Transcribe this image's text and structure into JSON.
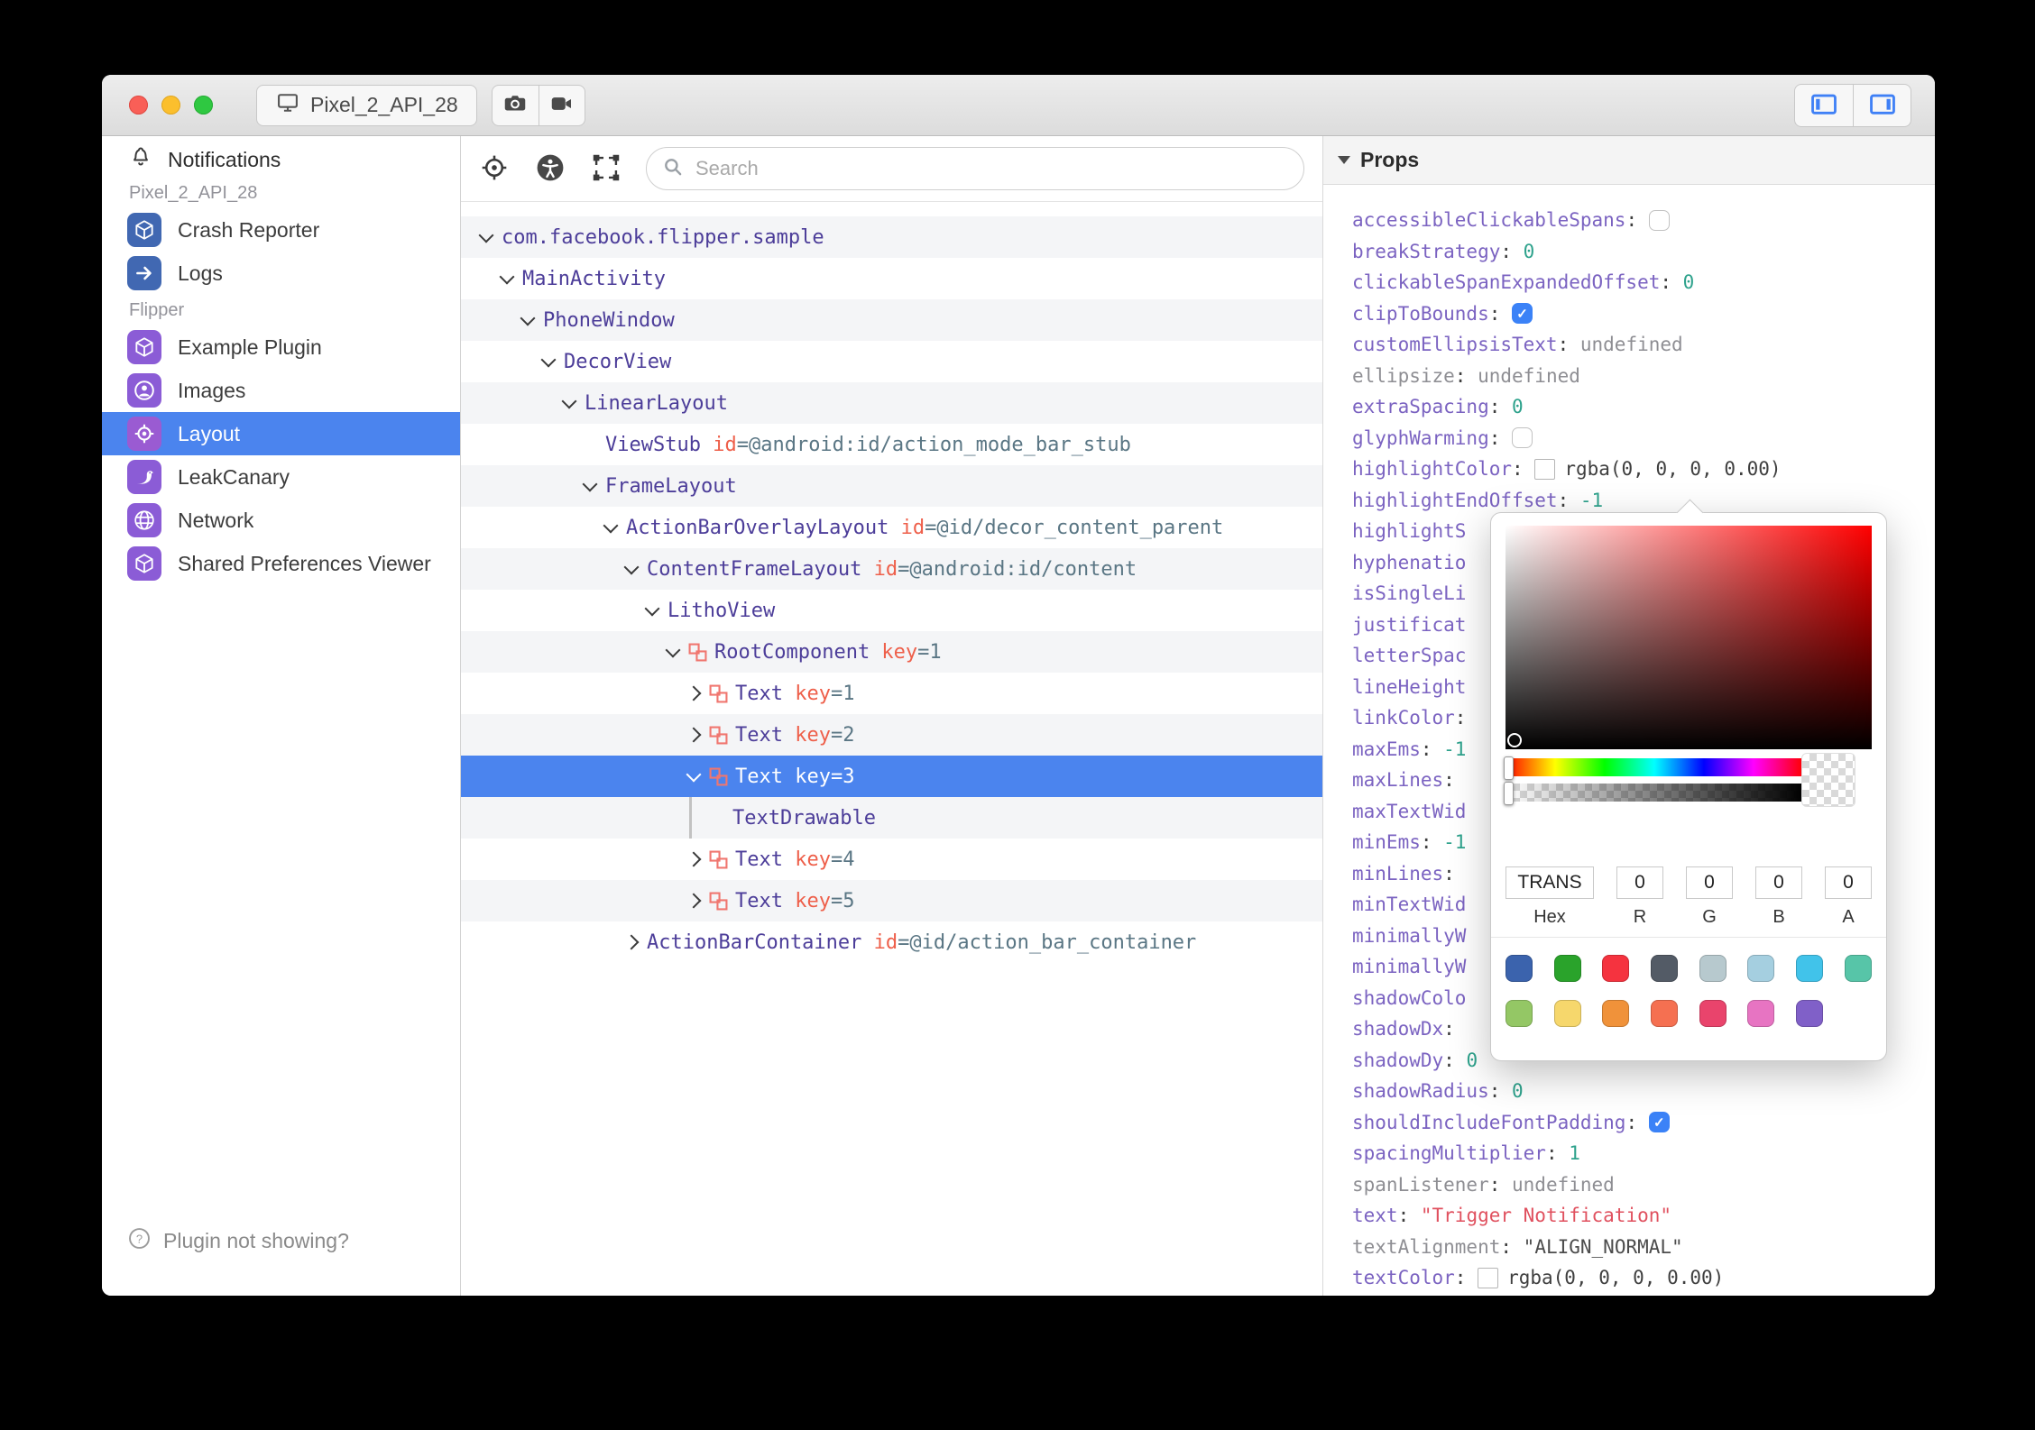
{
  "titlebar": {
    "device_label": "Pixel_2_API_28"
  },
  "sidebar": {
    "notifications": {
      "label": "Notifications",
      "icon": "bell-icon"
    },
    "sections": [
      {
        "label": "Pixel_2_API_28",
        "items": [
          {
            "label": "Crash Reporter",
            "icon": "cube-icon",
            "color": "#4168b2",
            "selected": false
          },
          {
            "label": "Logs",
            "icon": "arrow-right-icon",
            "color": "#4168b2",
            "selected": false
          }
        ]
      },
      {
        "label": "Flipper",
        "items": [
          {
            "label": "Example Plugin",
            "icon": "cube-icon",
            "color": "#8b5cd6",
            "selected": false
          },
          {
            "label": "Images",
            "icon": "person-circle-icon",
            "color": "#8b5cd6",
            "selected": false
          },
          {
            "label": "Layout",
            "icon": "target-icon",
            "color": "#9a5bd2",
            "selected": true
          },
          {
            "label": "LeakCanary",
            "icon": "bird-icon",
            "color": "#8b5cd6",
            "selected": false
          },
          {
            "label": "Network",
            "icon": "globe-icon",
            "color": "#8b5cd6",
            "selected": false
          },
          {
            "label": "Shared Preferences Viewer",
            "icon": "cube-icon",
            "color": "#8b5cd6",
            "selected": false
          }
        ]
      }
    ],
    "footer": {
      "label": "Plugin not showing?",
      "icon": "help-circle-icon"
    }
  },
  "toolbar": {
    "search_placeholder": "Search"
  },
  "tree": {
    "rows": [
      {
        "name": "com.facebook.flipper.sample",
        "level": 0,
        "exp": "open"
      },
      {
        "name": "MainActivity",
        "level": 1,
        "exp": "open"
      },
      {
        "name": "PhoneWindow",
        "level": 2,
        "exp": "open"
      },
      {
        "name": "DecorView",
        "level": 3,
        "exp": "open"
      },
      {
        "name": "LinearLayout",
        "level": 4,
        "exp": "open"
      },
      {
        "name": "ViewStub",
        "level": 5,
        "exp": "none",
        "attr": {
          "k": "id",
          "v": "=@android:id/action_mode_bar_stub"
        }
      },
      {
        "name": "FrameLayout",
        "level": 5,
        "exp": "open"
      },
      {
        "name": "ActionBarOverlayLayout",
        "level": 6,
        "exp": "open",
        "attr": {
          "k": "id",
          "v": "=@id/decor_content_parent"
        }
      },
      {
        "name": "ContentFrameLayout",
        "level": 7,
        "exp": "open",
        "attr": {
          "k": "id",
          "v": "=@android:id/content"
        }
      },
      {
        "name": "LithoView",
        "level": 8,
        "exp": "open"
      },
      {
        "name": "RootComponent",
        "level": 9,
        "exp": "open",
        "litho": true,
        "attr": {
          "k": "key",
          "v": "=1"
        }
      },
      {
        "name": "Text",
        "level": 10,
        "exp": "closed",
        "litho": true,
        "attr": {
          "k": "key",
          "v": "=1"
        }
      },
      {
        "name": "Text",
        "level": 10,
        "exp": "closed",
        "litho": true,
        "attr": {
          "k": "key",
          "v": "=2"
        }
      },
      {
        "name": "Text",
        "level": 10,
        "exp": "open",
        "litho": true,
        "selected": true,
        "attr": {
          "k": "key",
          "v": "=3"
        }
      },
      {
        "name": "TextDrawable",
        "level": 10,
        "exp": "bar",
        "extra": 1
      },
      {
        "name": "Text",
        "level": 10,
        "exp": "closed",
        "litho": true,
        "attr": {
          "k": "key",
          "v": "=4"
        }
      },
      {
        "name": "Text",
        "level": 10,
        "exp": "closed",
        "litho": true,
        "attr": {
          "k": "key",
          "v": "=5"
        }
      },
      {
        "name": "ActionBarContainer",
        "level": 7,
        "exp": "closed",
        "attr": {
          "k": "id",
          "v": "=@id/action_bar_container"
        }
      }
    ]
  },
  "props": {
    "title": "Props",
    "rows": [
      {
        "key": "accessibleClickableSpans",
        "colon": true,
        "value": {
          "kind": "checkbox",
          "checked": false
        }
      },
      {
        "key": "breakStrategy",
        "colon": true,
        "value": {
          "kind": "num",
          "text": "0"
        }
      },
      {
        "key": "clickableSpanExpandedOffset",
        "colon": true,
        "value": {
          "kind": "num",
          "text": "0"
        }
      },
      {
        "key": "clipToBounds",
        "colon": true,
        "value": {
          "kind": "checkbox",
          "checked": true
        }
      },
      {
        "key": "customEllipsisText",
        "colon": true,
        "value": {
          "kind": "undef",
          "text": "undefined"
        }
      },
      {
        "key": "ellipsize",
        "colon": true,
        "muted": true,
        "value": {
          "kind": "undef",
          "text": "undefined"
        }
      },
      {
        "key": "extraSpacing",
        "colon": true,
        "value": {
          "kind": "num",
          "text": "0"
        }
      },
      {
        "key": "glyphWarming",
        "colon": true,
        "value": {
          "kind": "checkbox",
          "checked": false
        }
      },
      {
        "key": "highlightColor",
        "colon": true,
        "value": {
          "kind": "color",
          "text": "rgba(0, 0, 0, 0.00)"
        }
      },
      {
        "key": "highlightEndOffset",
        "colon": true,
        "value": {
          "kind": "num",
          "text": "-1"
        }
      },
      {
        "key": "highlightS",
        "colon": false,
        "value": {
          "kind": "none"
        }
      },
      {
        "key": "hyphenatio",
        "colon": false,
        "value": {
          "kind": "none"
        }
      },
      {
        "key": "isSingleLi",
        "colon": false,
        "value": {
          "kind": "none"
        }
      },
      {
        "key": "justificat",
        "colon": false,
        "value": {
          "kind": "none"
        }
      },
      {
        "key": "letterSpac",
        "colon": false,
        "value": {
          "kind": "none"
        }
      },
      {
        "key": "lineHeight",
        "colon": false,
        "value": {
          "kind": "none"
        }
      },
      {
        "key": "linkColor",
        "colon": true,
        "value": {
          "kind": "none"
        }
      },
      {
        "key": "maxEms",
        "colon": true,
        "value": {
          "kind": "num",
          "text": "-1"
        }
      },
      {
        "key": "maxLines",
        "colon": true,
        "value": {
          "kind": "none"
        }
      },
      {
        "key": "maxTextWid",
        "colon": false,
        "value": {
          "kind": "none"
        }
      },
      {
        "key": "minEms",
        "colon": true,
        "value": {
          "kind": "num",
          "text": "-1"
        }
      },
      {
        "key": "minLines",
        "colon": true,
        "value": {
          "kind": "none"
        }
      },
      {
        "key": "minTextWid",
        "colon": false,
        "value": {
          "kind": "none"
        }
      },
      {
        "key": "minimallyW",
        "colon": false,
        "value": {
          "kind": "none"
        }
      },
      {
        "key": "minimallyW",
        "colon": false,
        "value": {
          "kind": "none"
        }
      },
      {
        "key": "shadowColo",
        "colon": false,
        "value": {
          "kind": "none"
        }
      },
      {
        "key": "shadowDx",
        "colon": true,
        "value": {
          "kind": "none"
        }
      },
      {
        "key": "shadowDy",
        "colon": true,
        "value": {
          "kind": "num",
          "text": "0"
        }
      },
      {
        "key": "shadowRadius",
        "colon": true,
        "value": {
          "kind": "num",
          "text": "0"
        }
      },
      {
        "key": "shouldIncludeFontPadding",
        "colon": true,
        "value": {
          "kind": "checkbox",
          "checked": true
        }
      },
      {
        "key": "spacingMultiplier",
        "colon": true,
        "value": {
          "kind": "num",
          "text": "1"
        }
      },
      {
        "key": "spanListener",
        "colon": true,
        "muted": true,
        "value": {
          "kind": "undef",
          "text": "undefined"
        }
      },
      {
        "key": "text",
        "colon": true,
        "value": {
          "kind": "str",
          "text": "\"Trigger Notification\""
        }
      },
      {
        "key": "textAlignment",
        "colon": true,
        "muted": true,
        "value": {
          "kind": "strdark",
          "text": "\"ALIGN_NORMAL\""
        }
      },
      {
        "key": "textColor",
        "colon": true,
        "value": {
          "kind": "color",
          "text": "rgba(0, 0, 0, 0.00)"
        }
      }
    ]
  },
  "picker": {
    "hex": "TRANS",
    "r": "0",
    "g": "0",
    "b": "0",
    "a": "0",
    "labels": {
      "hex": "Hex",
      "r": "R",
      "g": "G",
      "b": "B",
      "a": "A"
    },
    "swatches_row1": [
      "#3b63ad",
      "#2aa32b",
      "#f5333f",
      "#535b66",
      "#b7c9ce",
      "#a5cfe0",
      "#41c3ea",
      "#57c5a8"
    ],
    "swatches_row2": [
      "#94c765",
      "#f6d76c",
      "#f0923a",
      "#f57051",
      "#e9446c",
      "#e774c2",
      "#8060c8"
    ]
  }
}
